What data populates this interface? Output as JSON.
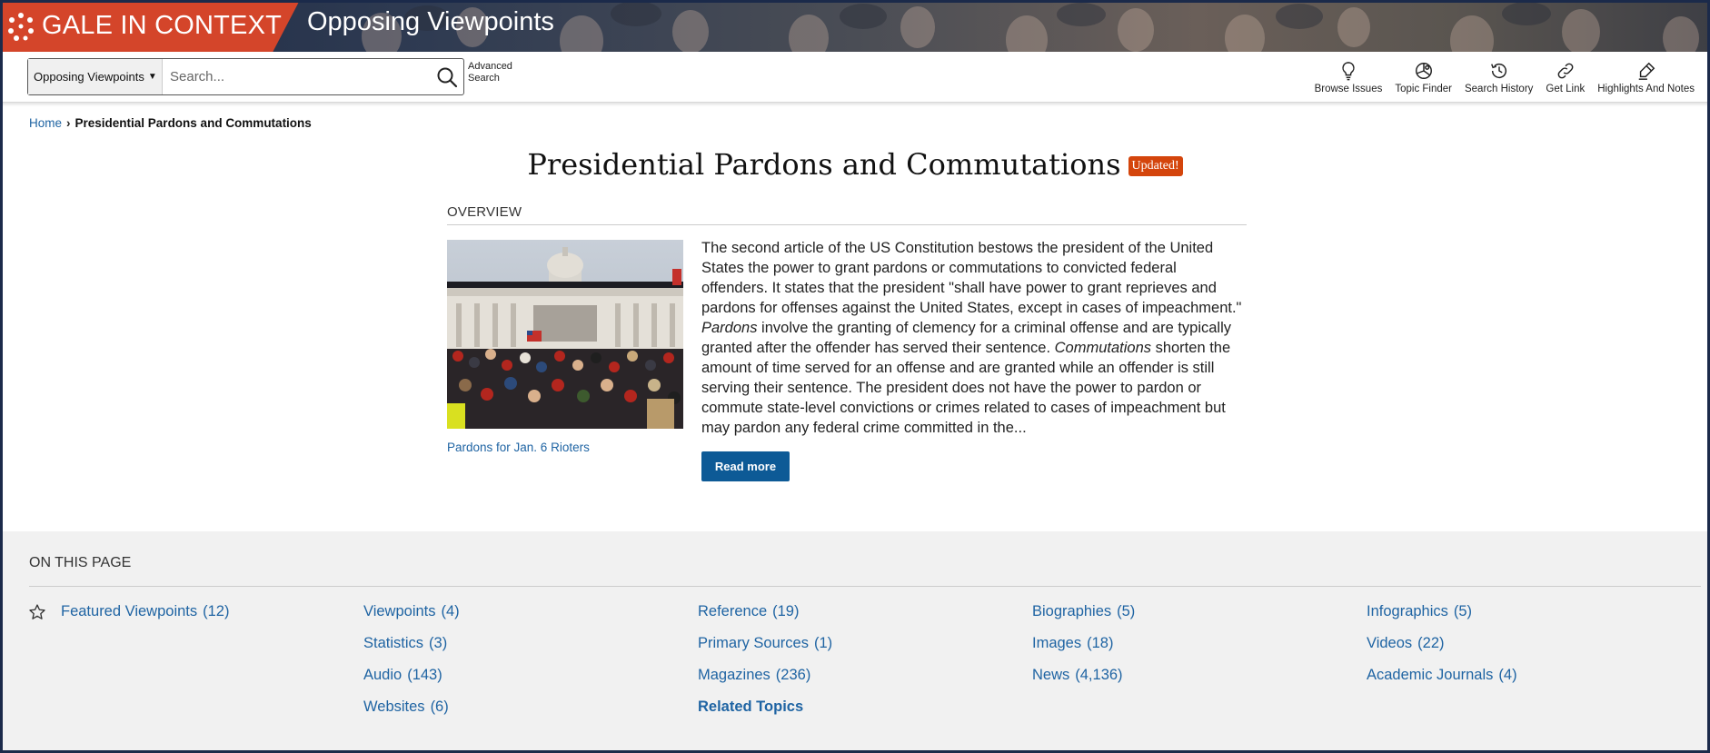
{
  "brand": {
    "name": "GALE IN CONTEXT",
    "product": "Opposing Viewpoints"
  },
  "search": {
    "scope_selected": "Opposing Viewpoints",
    "placeholder": "Search...",
    "advanced_line1": "Advanced",
    "advanced_line2": "Search"
  },
  "tools": [
    {
      "label": "Browse Issues",
      "icon": "lightbulb-icon"
    },
    {
      "label": "Topic Finder",
      "icon": "topic-finder-icon"
    },
    {
      "label": "Search History",
      "icon": "history-icon"
    },
    {
      "label": "Get Link",
      "icon": "link-icon"
    },
    {
      "label": "Highlights And Notes",
      "icon": "highlighter-icon"
    }
  ],
  "breadcrumb": {
    "home": "Home",
    "current": "Presidential Pardons and Commutations"
  },
  "page": {
    "title": "Presidential Pardons and Commutations",
    "badge": "Updated!",
    "overview_label": "OVERVIEW",
    "image_caption": "Pardons for Jan. 6 Rioters",
    "overview_p1": "The second article of the US Constitution bestows the president of the United States the power to grant pardons or commutations to convicted federal offenders. It states that the president \"shall have power to grant reprieves and pardons for offenses against the United States, except in cases of impeachment.\" ",
    "overview_em1": "Pardons",
    "overview_p2": " involve the granting of clemency for a criminal offense and are typically granted after the offender has served their sentence. ",
    "overview_em2": "Commutations",
    "overview_p3": " shorten the amount of time served for an offense and are granted while an offender is still serving their sentence. The president does not have the power to pardon or commute state-level convictions or crimes related to cases of impeachment but may pardon any federal crime committed in the...",
    "read_more": "Read more"
  },
  "on_this_page": {
    "title": "ON THIS PAGE",
    "items": [
      {
        "label": "Featured Viewpoints",
        "count": "(12)"
      },
      {
        "label": "Viewpoints",
        "count": "(4)"
      },
      {
        "label": "Reference",
        "count": "(19)"
      },
      {
        "label": "Biographies",
        "count": "(5)"
      },
      {
        "label": "Infographics",
        "count": "(5)"
      },
      {
        "label": "Statistics",
        "count": "(3)"
      },
      {
        "label": "Primary Sources",
        "count": "(1)"
      },
      {
        "label": "Images",
        "count": "(18)"
      },
      {
        "label": "Videos",
        "count": "(22)"
      },
      {
        "label": "Audio",
        "count": "(143)"
      },
      {
        "label": "Magazines",
        "count": "(236)"
      },
      {
        "label": "News",
        "count": "(4,136)"
      },
      {
        "label": "Academic Journals",
        "count": "(4)"
      },
      {
        "label": "Websites",
        "count": "(6)"
      },
      {
        "label": "Related Topics",
        "count": ""
      }
    ]
  },
  "colors": {
    "brand": "#d4452a",
    "link": "#1f64a3",
    "button": "#0d5a96",
    "badge": "#d4450c"
  }
}
